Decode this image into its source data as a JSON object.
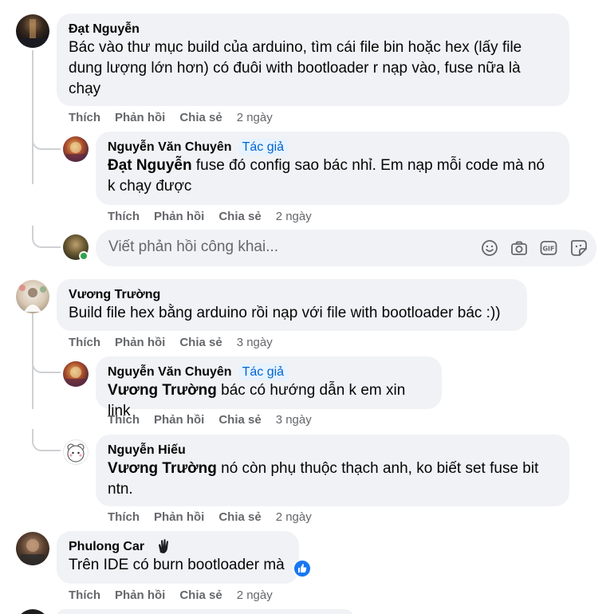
{
  "comments": [
    {
      "author": "Đạt Nguyễn",
      "text_lines": [
        "Bác vào thư mục build của arduino, tìm cái file bin hoặc hex (lấy file",
        "dung lượng lớn hơn) có đuôi with bootloader r nạp vào, fuse nữa là",
        "chạy"
      ],
      "time": "2 ngày",
      "avatar_icon": "dark-night-photo-avatar",
      "replies": [
        {
          "author": "Nguyễn Văn Chuyên",
          "tag": "Tác giả",
          "mention": "Đạt Nguyễn",
          "text_lines": [
            " fuse đó config sao bác nhỉ. Em nạp mỗi code mà nó",
            "k chạy được"
          ],
          "time": "2 ngày",
          "avatar_icon": "colorful-photo-avatar"
        }
      ],
      "reply_box": {
        "placeholder": "Viết phản hồi công khai..."
      }
    },
    {
      "author": "Vương Trường",
      "text_lines": [
        "Build file hex bằng arduino rồi nạp với file with bootloader bác :))"
      ],
      "time": "3 ngày",
      "avatar_icon": "wedding-photo-avatar",
      "replies": [
        {
          "author": "Nguyễn Văn Chuyên",
          "tag": "Tác giả",
          "mention": "Vương Trường",
          "text_lines": [
            " bác có hướng dẫn k em xin link"
          ],
          "time": "3 ngày",
          "avatar_icon": "colorful-photo-avatar"
        },
        {
          "author": "Nguyễn Hiếu",
          "mention": "Vương Trường",
          "text_lines": [
            " nó còn phụ thuộc thạch anh, ko biết set fuse bit",
            "ntn."
          ],
          "time": "2 ngày",
          "avatar_icon": "cartoon-bear-avatar"
        }
      ]
    },
    {
      "author": "Phulong Car",
      "badge_icon": "waving-hand-icon",
      "text_lines": [
        "Trên IDE có burn bootloader mà"
      ],
      "time": "2 ngày",
      "avatar_icon": "portrait-photo-avatar",
      "reaction_icon": "like-thumb-icon"
    }
  ],
  "actions": {
    "like": "Thích",
    "reply": "Phản hồi",
    "share": "Chia sẻ"
  },
  "reply_tools": [
    "emoji-icon",
    "camera-icon",
    "gif-icon",
    "sticker-icon"
  ],
  "colors": {
    "bubble": "#f0f2f5",
    "secondary_text": "#65676b",
    "tag_bg": "#e7f3ff",
    "tag_text": "#0064d1",
    "like_blue": "#1877f2",
    "online_green": "#31a24c"
  }
}
